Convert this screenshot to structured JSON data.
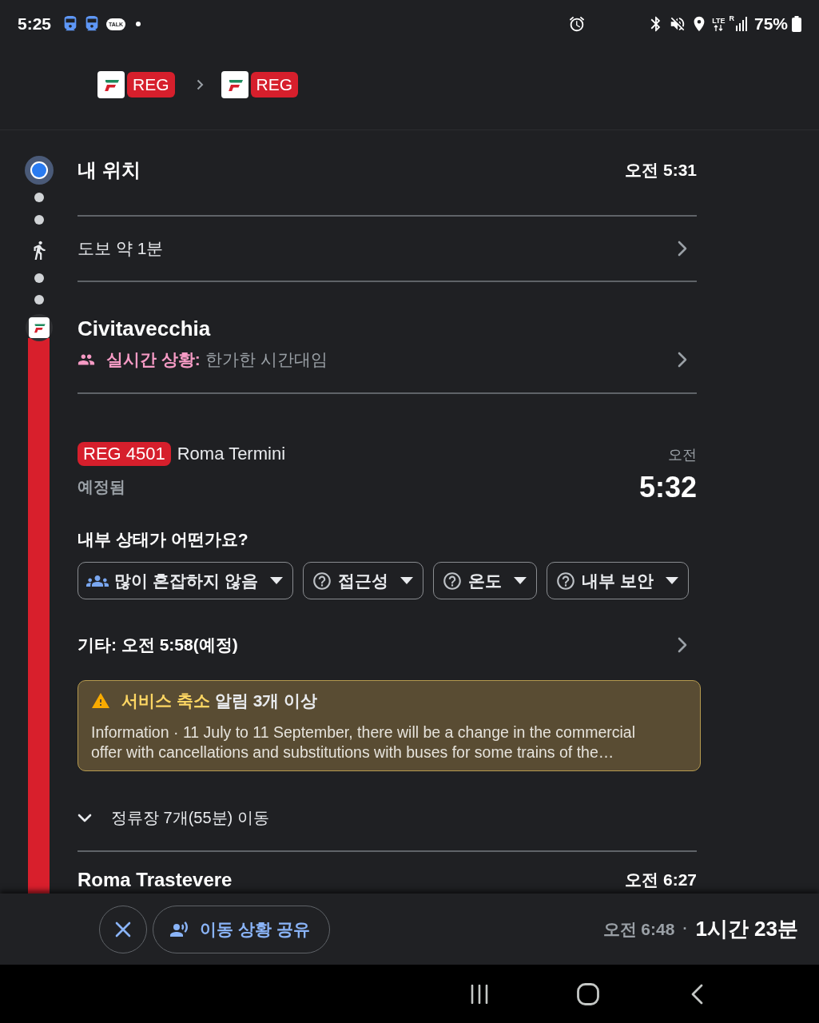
{
  "status_bar": {
    "time": "5:25",
    "talk_badge": "TALK",
    "network": "LTE",
    "roaming": "R",
    "battery": "75%"
  },
  "route_header": {
    "legs": [
      {
        "label": "REG"
      },
      {
        "label": "REG"
      }
    ]
  },
  "origin": {
    "name": "내 위치",
    "time": "오전 5:31"
  },
  "walk": {
    "label": "도보 약 1분"
  },
  "station": {
    "name": "Civitavecchia",
    "live_label": "실시간 상황:",
    "live_value": "한가한 시간대임"
  },
  "train": {
    "line": "REG 4501",
    "destination": "Roma Termini",
    "status": "예정됨",
    "time_period": "오전",
    "time": "5:32"
  },
  "conditions": {
    "question": "내부 상태가 어떤가요?",
    "chips": [
      {
        "kind": "crowd",
        "label": "많이 혼잡하지 않음"
      },
      {
        "kind": "question",
        "label": "접근성"
      },
      {
        "kind": "question",
        "label": "온도"
      },
      {
        "kind": "question",
        "label": "내부 보안"
      }
    ]
  },
  "other_departures": {
    "label": "기타: 오전 5:58(예정)"
  },
  "alert": {
    "highlight": "서비스 축소",
    "title": "알림 3개 이상",
    "body": "Information · 11 July to 11 September, there will be a change in the commercial offer with cancellations and substitutions with buses for some trains of the…"
  },
  "stops_toggle": {
    "label": "정류장 7개(55분) 이동",
    "expanded": false
  },
  "next_stop": {
    "name": "Roma Trastevere",
    "time": "오전 6:27"
  },
  "bottom_bar": {
    "share_label": "이동 상황 공유",
    "arrival": "오전 6:48",
    "separator": "·",
    "duration": "1시간 23분"
  }
}
